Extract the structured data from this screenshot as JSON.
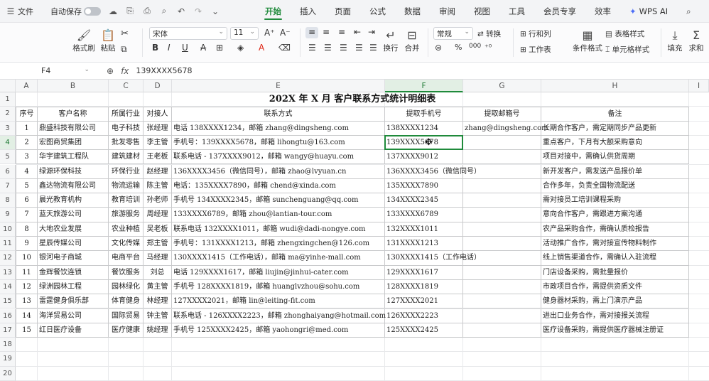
{
  "menubar": {
    "menu_icon": "hamburger-icon",
    "file_label": "文件",
    "autosave_label": "自动保存",
    "tabs": [
      "开始",
      "插入",
      "页面",
      "公式",
      "数据",
      "审阅",
      "视图",
      "工具",
      "会员专享",
      "效率"
    ],
    "active_tab": "开始",
    "wps_ai": "WPS AI"
  },
  "ribbon": {
    "format_painter": "格式刷",
    "paste": "粘贴",
    "font_name": "宋体",
    "font_size": "11",
    "number_format": "常规",
    "convert": "转换",
    "rows_cols": "行和列",
    "worksheet": "工作表",
    "wrap": "换行",
    "merge": "合并",
    "table_style": "表格样式",
    "cell_style": "单元格样式",
    "cond_format": "条件格式",
    "fill": "填充",
    "sum": "求和",
    "percent": "%",
    "thousands": "000"
  },
  "formula_bar": {
    "cell_ref": "F4",
    "value": "139XXXX5678"
  },
  "columns": [
    "A",
    "B",
    "C",
    "D",
    "E",
    "F",
    "G",
    "H",
    "I"
  ],
  "rows": [
    "1",
    "2",
    "3",
    "4",
    "5",
    "6",
    "7",
    "8",
    "9",
    "10",
    "11",
    "12",
    "13",
    "14",
    "15",
    "16",
    "17",
    "18",
    "19",
    "20"
  ],
  "sheet": {
    "title": "202X 年 X 月 客户联系方式统计明细表",
    "headers": [
      "序号",
      "客户名称",
      "所属行业",
      "对接人",
      "联系方式",
      "提取手机号",
      "提取邮箱号",
      "备注"
    ],
    "records": [
      [
        "1",
        "鼎盛科技有限公司",
        "电子科技",
        "张经理",
        "电话 138XXXX1234，邮箱 zhang@dingsheng.com",
        "138XXXX1234",
        "zhang@dingsheng.com",
        "长期合作客户，需定期同步产品更新"
      ],
      [
        "2",
        "宏图商贸集团",
        "批发零售",
        "李主管",
        "手机号：139XXXX5678，邮箱 lihongtu@163.com",
        "139XXXX5678",
        "",
        "重点客户，下月有大额采购意向"
      ],
      [
        "3",
        "华宇建筑工程队",
        "建筑建材",
        "王老板",
        "联系电话 - 137XXXX9012，邮箱 wangy@huayu.com",
        "137XXXX9012",
        "",
        "项目对接中，需确认供货周期"
      ],
      [
        "4",
        "绿源环保科技",
        "环保行业",
        "赵经理",
        "136XXXX3456（微信同号），邮箱 zhao@lvyuan.cn",
        "136XXXX3456（微信同号）",
        "",
        "新开发客户，需发送产品报价单"
      ],
      [
        "5",
        "鑫达物流有限公司",
        "物流运输",
        "陈主管",
        "电话：135XXXX7890，邮箱 chend@xinda.com",
        "135XXXX7890",
        "",
        "合作多年，负责全国物流配送"
      ],
      [
        "6",
        "晨光教育机构",
        "教育培训",
        "孙老师",
        "手机号 134XXXX2345，邮箱 sunchenguang@qq.com",
        "134XXXX2345",
        "",
        "需对接员工培训课程采购"
      ],
      [
        "7",
        "蓝天旅游公司",
        "旅游服务",
        "周经理",
        "133XXXX6789，邮箱 zhou@lantian-tour.com",
        "133XXXX6789",
        "",
        "意向合作客户，需跟进方案沟通"
      ],
      [
        "8",
        "大地农业发展",
        "农业种植",
        "吴老板",
        "联系电话 132XXXX1011，邮箱 wudi@dadi-nongye.com",
        "132XXXX1011",
        "",
        "农产品采购合作，需确认质检报告"
      ],
      [
        "9",
        "星辰传媒公司",
        "文化传媒",
        "郑主管",
        "手机号：131XXXX1213，邮箱 zhengxingchen@126.com",
        "131XXXX1213",
        "",
        "活动推广合作，需对接宣传物料制作"
      ],
      [
        "10",
        "银河电子商城",
        "电商平台",
        "马经理",
        "130XXXX1415（工作电话），邮箱 ma@yinhe-mall.com",
        "130XXXX1415（工作电话）",
        "",
        "线上销售渠道合作，需确认入驻流程"
      ],
      [
        "11",
        "金辉餐饮连锁",
        "餐饮服务",
        "刘总",
        "电话 129XXXX1617，邮箱 liujin@jinhui-cater.com",
        "129XXXX1617",
        "",
        "门店设备采购，需批量报价"
      ],
      [
        "12",
        "绿洲园林工程",
        "园林绿化",
        "黄主管",
        "手机号 128XXXX1819，邮箱 huanglvzhou@sohu.com",
        "128XXXX1819",
        "",
        "市政项目合作，需提供资质文件"
      ],
      [
        "13",
        "雷霆健身俱乐部",
        "体育健身",
        "林经理",
        "127XXXX2021，邮箱 lin@leiting-fit.com",
        "127XXXX2021",
        "",
        "健身器材采购，需上门演示产品"
      ],
      [
        "14",
        "海洋贸易公司",
        "国际贸易",
        "钟主管",
        "联系电话 - 126XXXX2223，邮箱 zhonghaiyang@hotmail.com",
        "126XXXX2223",
        "",
        "进出口业务合作，需对接报关流程"
      ],
      [
        "15",
        "红日医疗设备",
        "医疗健康",
        "姚经理",
        "手机号 125XXXX2425，邮箱 yaohongri@med.com",
        "125XXXX2425",
        "",
        "医疗设备采购，需提供医疗器械注册证"
      ]
    ]
  }
}
